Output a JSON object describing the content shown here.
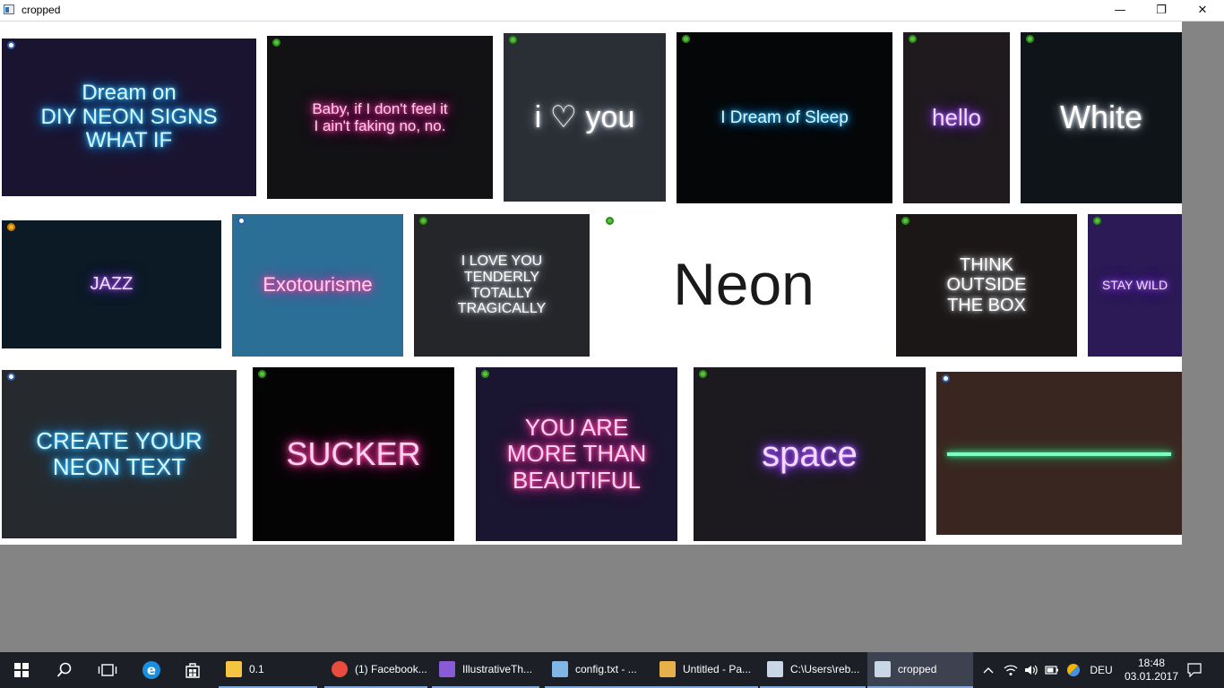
{
  "window": {
    "title": "cropped",
    "controls": {
      "minimize": "—",
      "restore": "❐",
      "close": "✕"
    }
  },
  "gallery": {
    "rows": [
      [
        {
          "text": "Dream on\nDIY NEON SIGNS\nWHAT IF",
          "badge": "blue",
          "bg": "#1a1430",
          "glow": "blue"
        },
        {
          "text": "Baby, if I don't feel it\nI ain't faking no, no.",
          "badge": "green",
          "bg": "#121114",
          "glow": "pink"
        },
        {
          "text": "i ♡ you",
          "badge": "green",
          "bg": "#2a2f36",
          "glow": "white"
        },
        {
          "text": "I Dream of Sleep",
          "badge": "green",
          "bg": "#050607",
          "glow": "blue"
        },
        {
          "text": "hello",
          "badge": "green",
          "bg": "#1f1a1e",
          "glow": "purple"
        },
        {
          "text": "White",
          "badge": "green",
          "bg": "#0e1418",
          "glow": "white"
        }
      ],
      [
        {
          "text": "JAZZ",
          "badge": "orange",
          "bg": "#0b1a24",
          "glow": "purple"
        },
        {
          "text": "Exotourisme",
          "badge": "blue",
          "bg": "#2c6f96",
          "glow": "pink"
        },
        {
          "text": "I LOVE YOU\nTENDERLY\nTOTALLY\nTRAGICALLY",
          "badge": "green",
          "bg": "#24262a",
          "glow": "white"
        },
        {
          "text": "Neon",
          "badge": "green",
          "bg": "#ffffff",
          "glow": "none"
        },
        {
          "text": "THINK\nOUTSIDE\nTHE BOX",
          "badge": "green",
          "bg": "#1b1716",
          "glow": "white"
        },
        {
          "text": "STAY WILD",
          "badge": "green",
          "bg": "#2b1a55",
          "glow": "purple"
        }
      ],
      [
        {
          "text": "CREATE YOUR\nNEON TEXT",
          "badge": "blue",
          "bg": "#262a2e",
          "glow": "blue"
        },
        {
          "text": "SUCKER",
          "badge": "green",
          "bg": "#050405",
          "glow": "pink"
        },
        {
          "text": "YOU ARE\nMORE THAN\nBEAUTIFUL",
          "badge": "green",
          "bg": "#1a1530",
          "glow": "pink"
        },
        {
          "text": "space",
          "badge": "green",
          "bg": "#1c1a1f",
          "glow": "purple"
        },
        {
          "text": "",
          "badge": "blue",
          "bg": "#3a2620",
          "glow": "green"
        }
      ]
    ]
  },
  "taskbar": {
    "start_icon": "windows-start-icon",
    "search_icon": "search-icon",
    "task_view_icon": "task-view-icon",
    "pinned": [
      "edge-icon",
      "store-icon"
    ],
    "apps": [
      {
        "label": "0.1",
        "icon": "folder-icon",
        "color": "#f4c542"
      },
      {
        "label": "(1) Facebook...",
        "icon": "chrome-icon",
        "color": "#e74c3c"
      },
      {
        "label": "IllustrativeTh...",
        "icon": "visual-studio-icon",
        "color": "#8a5bd6"
      },
      {
        "label": "config.txt - ...",
        "icon": "notepad-icon",
        "color": "#7fb6e6"
      },
      {
        "label": "Untitled - Pa...",
        "icon": "paint-icon",
        "color": "#e8b04a"
      },
      {
        "label": "C:\\Users\\reb...",
        "icon": "console-icon",
        "color": "#c8d6e5"
      },
      {
        "label": "cropped",
        "icon": "image-window-icon",
        "color": "#c8d6e5"
      }
    ],
    "language": "DEU",
    "time": "18:48",
    "date": "03.01.2017"
  }
}
